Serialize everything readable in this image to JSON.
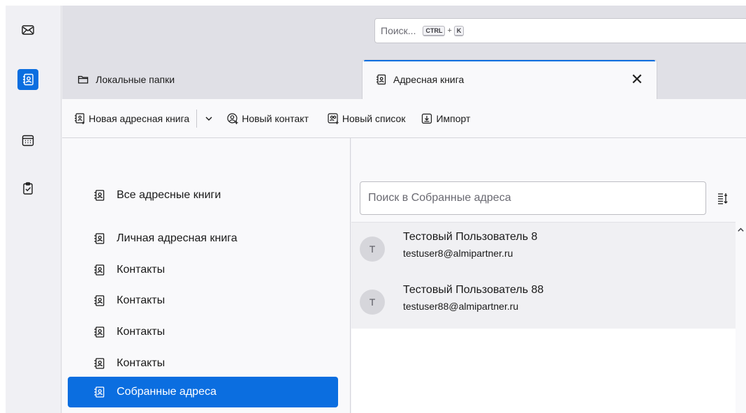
{
  "spaces": {
    "items": [
      {
        "name": "mail",
        "icon": "envelope-icon"
      },
      {
        "name": "address-book",
        "icon": "address-book-icon",
        "active": true
      },
      {
        "name": "calendar",
        "icon": "calendar-icon"
      },
      {
        "name": "tasks",
        "icon": "clipboard-icon"
      }
    ],
    "accent": "#0b6ee0"
  },
  "global_search": {
    "placeholder": "Поиск...",
    "shortcut_key1": "CTRL",
    "shortcut_plus": "+",
    "shortcut_key2": "K"
  },
  "tabs": [
    {
      "label": "Локальные папки",
      "icon": "folder-icon",
      "active": false
    },
    {
      "label": "Адресная книга",
      "icon": "address-book-icon",
      "active": true,
      "close": "✕"
    }
  ],
  "toolbar": {
    "new_book": "Новая адресная книга",
    "new_contact": "Новый контакт",
    "new_list": "Новый список",
    "import": "Импорт"
  },
  "books": {
    "items": [
      {
        "label": "Все адресные книги"
      },
      {
        "label": "Личная адресная книга"
      },
      {
        "label": "Контакты"
      },
      {
        "label": "Контакты"
      },
      {
        "label": "Контакты"
      },
      {
        "label": "Контакты"
      },
      {
        "label": "Собранные адреса",
        "selected": true
      }
    ]
  },
  "cards": {
    "search_placeholder": "Поиск в Собранные адреса",
    "contacts": [
      {
        "initial": "Т",
        "name": "Тестовый Пользователь 8",
        "email": "testuser8@almipartner.ru"
      },
      {
        "initial": "Т",
        "name": "Тестовый Пользователь 88",
        "email": "testuser88@almipartner.ru"
      }
    ]
  }
}
